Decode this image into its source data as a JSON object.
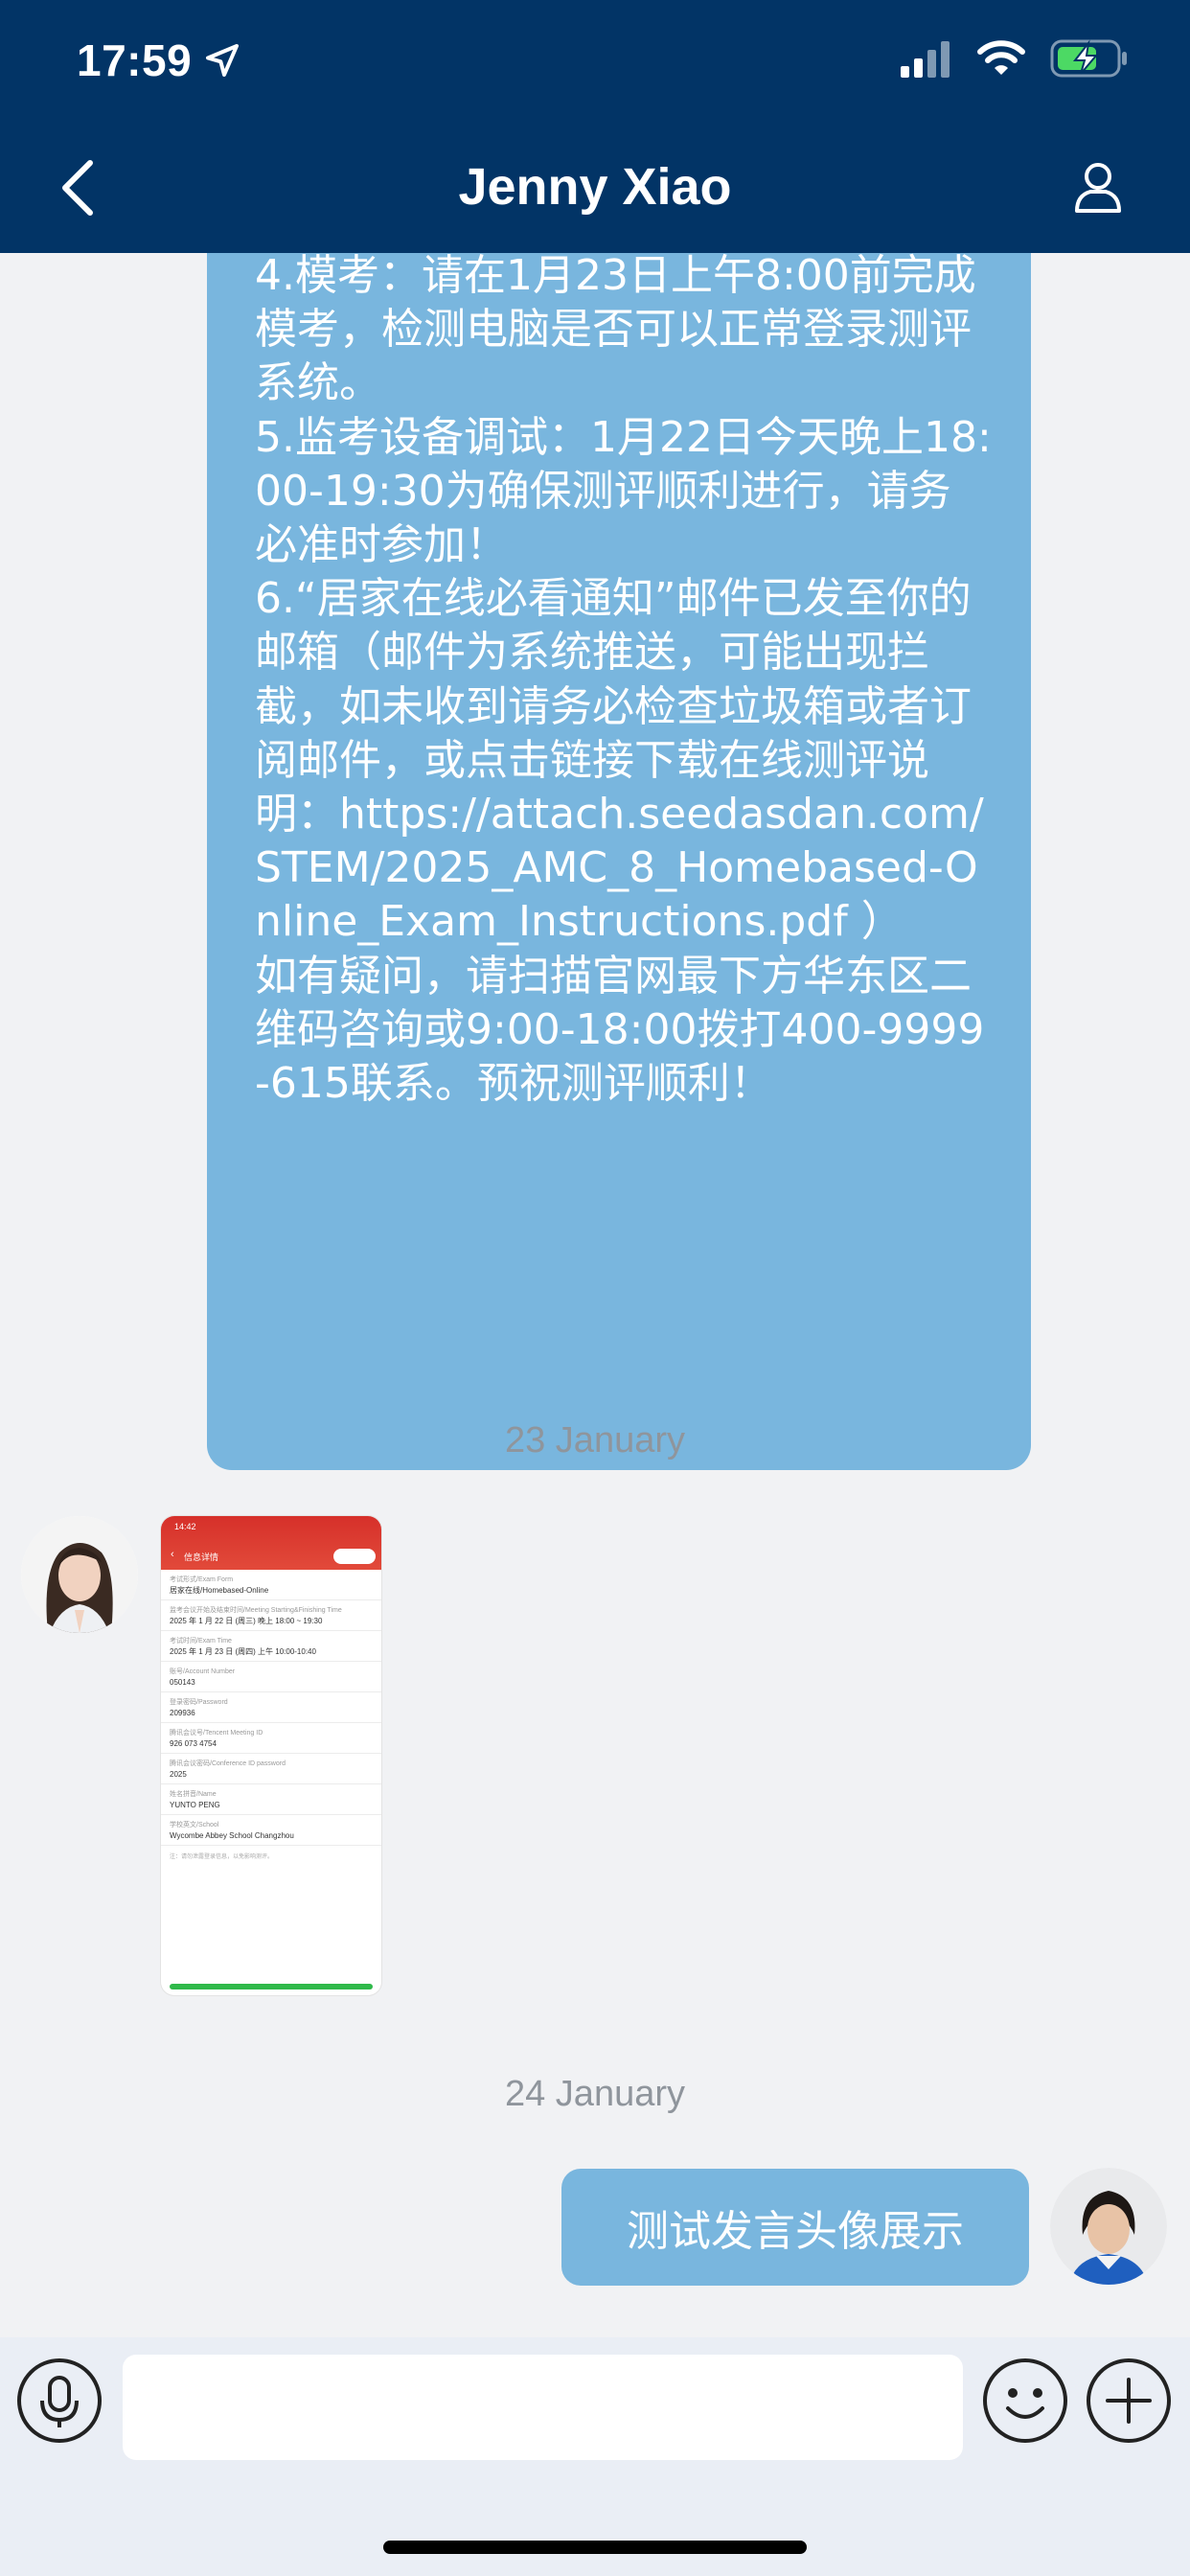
{
  "status_bar": {
    "time": "17:59"
  },
  "header": {
    "title": "Jenny Xiao"
  },
  "messages": {
    "long_lines": [
      "4.模考：请在1月23日上午8:00前完成模考，检测电脑是否可以正常登录测评系统。",
      "5.监考设备调试：1月22日今天晚上18:00-19:30为确保测评顺利进行，请务必准时参加！",
      "6.“居家在线必看通知”邮件已发至你的邮箱（邮件为系统推送，可能出现拦截，如未收到请务必检查垃圾箱或者订阅邮件，或点击链接下载在线测评说明：https://attach.seedasdan.com/STEM/2025_AMC_8_Homebased-Online_Exam_Instructions.pdf ）",
      "如有疑问，请扫描官网最下方华东区二维码咨询或9:00-18:00拨打400-9999-615联系。预祝测评顺利！"
    ],
    "date1": "23 January",
    "date2": "24 January",
    "outgoing_text": "测试发言头像展示"
  },
  "thumbnail": {
    "time": "14:42",
    "title": "信息详情",
    "rows": [
      {
        "label": "考试形式/Exam Form",
        "value": "居家在线/Homebased-Online"
      },
      {
        "label": "监考会议开始及结束时间/Meeting Starting&Finishing Time",
        "value": "2025 年 1 月 22 日 (周三) 晚上 18:00 ~ 19:30"
      },
      {
        "label": "考试时间/Exam Time",
        "value": "2025 年 1 月 23 日 (周四) 上午 10:00-10:40"
      },
      {
        "label": "账号/Account Number",
        "value": "050143"
      },
      {
        "label": "登录密码/Password",
        "value": "209936"
      },
      {
        "label": "腾讯会议号/Tencent Meeting ID",
        "value": "926 073 4754"
      },
      {
        "label": "腾讯会议密码/Conference ID password",
        "value": "2025"
      },
      {
        "label": "姓名拼音/Name",
        "value": "YUNTO PENG"
      },
      {
        "label": "学校英文/School",
        "value": "Wycombe Abbey School Changzhou"
      }
    ],
    "footnote": "注：请勿泄露登录信息，以免影响测评。"
  },
  "icons": {
    "location": "location-arrow-icon",
    "signal": "cellular-signal-icon",
    "wifi": "wifi-icon",
    "battery": "battery-charging-icon",
    "back": "chevron-left-icon",
    "contact": "person-icon",
    "voice": "microphone-icon",
    "emoji": "smiley-icon",
    "add": "plus-icon"
  },
  "colors": {
    "header_bg": "#023466",
    "bubble": "#79b6de",
    "battery_fill": "#4cd964"
  }
}
